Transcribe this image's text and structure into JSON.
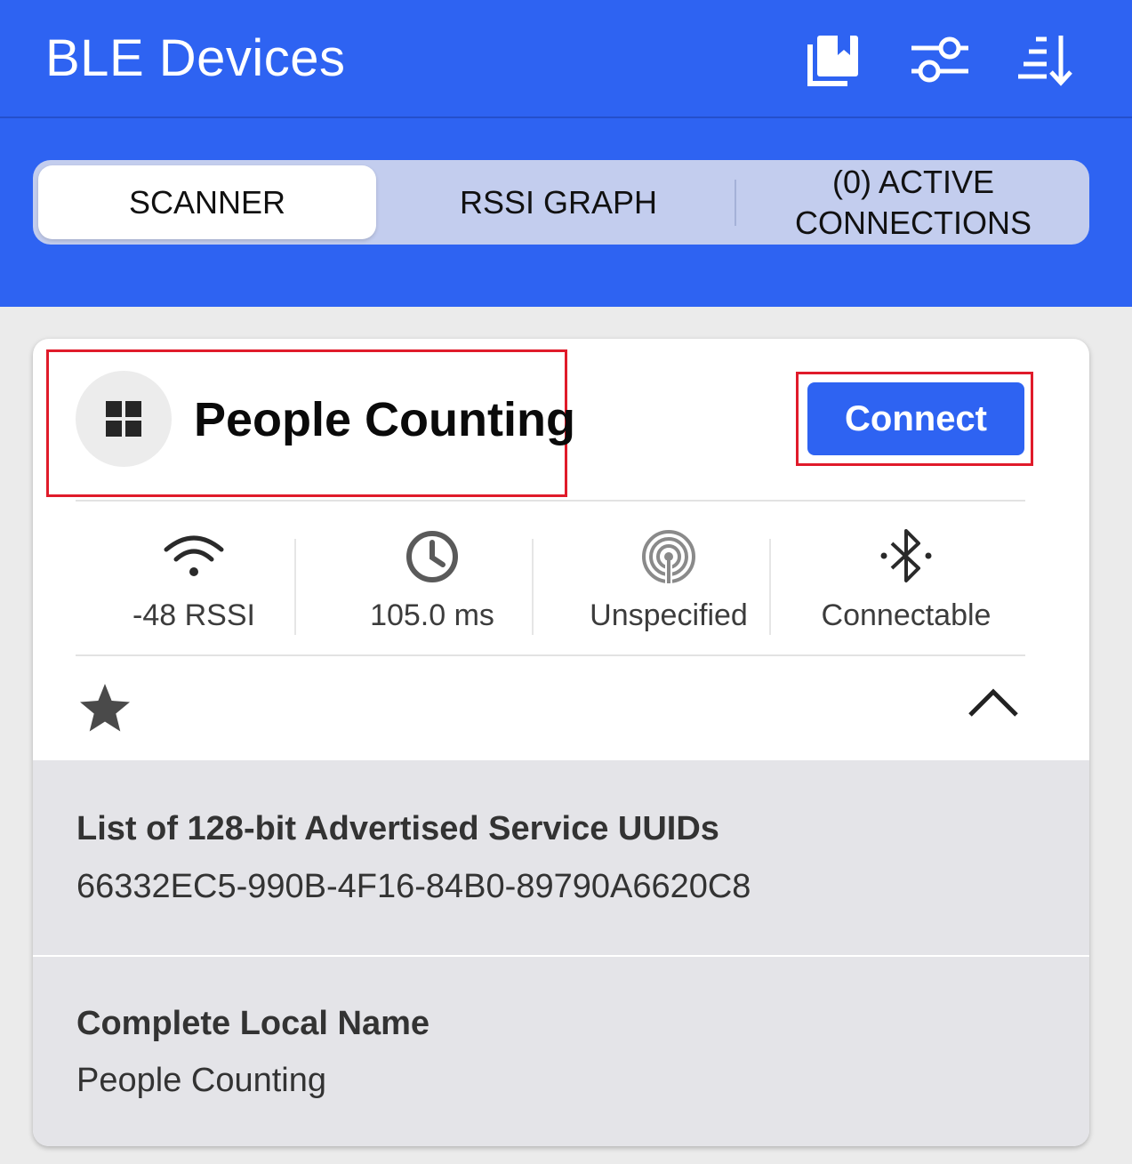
{
  "appbar": {
    "title": "BLE Devices",
    "icons": [
      "bookmarks-icon",
      "filter-sliders-icon",
      "sort-icon"
    ]
  },
  "tabs": [
    {
      "label": "SCANNER",
      "active": true
    },
    {
      "label": "RSSI GRAPH",
      "active": false
    },
    {
      "label": "(0) ACTIVE CONNECTIONS",
      "active": false
    }
  ],
  "colors": {
    "primary": "#2e63f2",
    "highlight": "#e01b2a"
  },
  "device": {
    "name": "People Counting",
    "icon": "grid-icon",
    "connect_label": "Connect",
    "stats": [
      {
        "icon": "wifi-signal-icon",
        "label": "-48 RSSI"
      },
      {
        "icon": "clock-icon",
        "label": "105.0 ms"
      },
      {
        "icon": "beacon-icon",
        "label": "Unspecified"
      },
      {
        "icon": "bluetooth-icon",
        "label": "Connectable"
      }
    ],
    "favorite_icon": "star-icon",
    "collapse_icon": "chevron-up-icon",
    "details": [
      {
        "title": "List of 128-bit Advertised Service UUIDs",
        "value": "66332EC5-990B-4F16-84B0-89790A6620C8"
      },
      {
        "title": "Complete Local Name",
        "value": "People Counting"
      }
    ]
  }
}
